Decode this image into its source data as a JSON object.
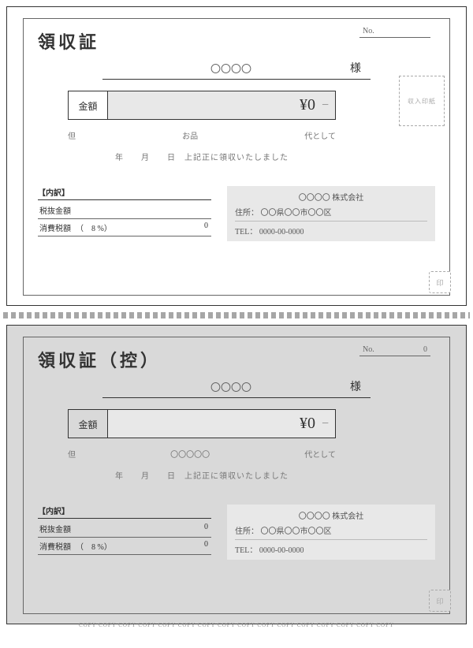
{
  "original": {
    "no_label": "No.",
    "no_value": "",
    "title": "領収証",
    "payer_placeholder": "〇〇〇〇",
    "sama": "様",
    "amount_label": "金額",
    "amount_value": "¥0",
    "amount_suffix": "−",
    "stamp_label": "収入印紙",
    "note_but": "但",
    "note_item": "お品",
    "note_as": "代として",
    "date_line": "年　　月　　日　上記正に領収いたしました",
    "breakdown_title": "【内訳】",
    "row1_label": "税抜金額",
    "row1_value": "",
    "row2_label": "消費税額",
    "row2_rate": "（　8 %）",
    "row2_value": "0",
    "issuer_name": "〇〇〇〇 株式会社",
    "issuer_addr_label": "住所：",
    "issuer_addr": "〇〇県〇〇市〇〇区",
    "issuer_tel_label": "TEL：",
    "issuer_tel": "0000-00-0000",
    "seal": "印"
  },
  "copy": {
    "no_label": "No.",
    "no_value": "0",
    "title": "領収証（控）",
    "payer_placeholder": "〇〇〇〇",
    "sama": "様",
    "amount_label": "金額",
    "amount_value": "¥0",
    "amount_suffix": "−",
    "note_but": "但",
    "note_item": "〇〇〇〇〇",
    "note_as": "代として",
    "date_line": "年　　月　　日　上記正に領収いたしました",
    "breakdown_title": "【内訳】",
    "row1_label": "税抜金額",
    "row1_value": "0",
    "row2_label": "消費税額",
    "row2_rate": "（　8 %）",
    "row2_value": "0",
    "issuer_name": "〇〇〇〇 株式会社",
    "issuer_addr_label": "住所：",
    "issuer_addr": "〇〇県〇〇市〇〇区",
    "issuer_tel_label": "TEL：",
    "issuer_tel": "0000-00-0000",
    "seal": "印",
    "watermark": "COPY COPY COPY COPY COPY COPY COPY COPY COPY COPY COPY COPY COPY COPY COPY COPY"
  }
}
